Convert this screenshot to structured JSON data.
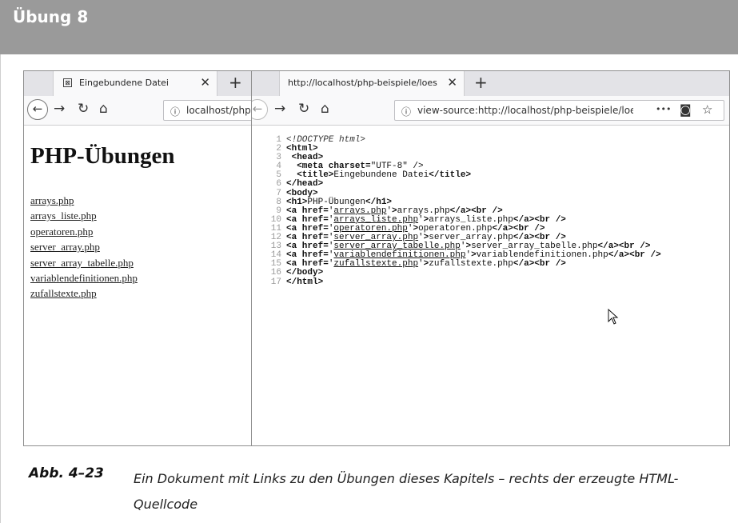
{
  "header": {
    "title": "Übung 8"
  },
  "left_browser": {
    "tab_label": "Eingebundene Datei",
    "url": "localhost/php",
    "page_heading": "PHP-Übungen",
    "links": [
      "arrays.php",
      "arrays_liste.php",
      "operatoren.php",
      "server_array.php",
      "server_array_tabelle.php",
      "variablendefinitionen.php",
      "zufallstexte.php"
    ]
  },
  "right_browser": {
    "tab_label": "http://localhost/php-beispiele/loes",
    "url": "view-source:http://localhost/php-beispiele/loe",
    "more_glyph": "•••",
    "source_lines": [
      "1",
      "2",
      "3",
      "4",
      "5",
      "6",
      "7",
      "8",
      "9",
      "10",
      "11",
      "12",
      "13",
      "14",
      "15",
      "16",
      "17"
    ]
  },
  "caption": {
    "label": "Abb. 4–23",
    "text": "Ein Dokument mit Links zu den Übungen dieses Kapitels – rechts der erzeugte HTML-Quellcode"
  },
  "icons": [
    "back-icon",
    "forward-icon",
    "reload-icon",
    "home-icon",
    "info-icon",
    "pocket-icon",
    "bookmark-star-icon",
    "close-icon",
    "new-tab-icon",
    "mouse-cursor-icon"
  ]
}
